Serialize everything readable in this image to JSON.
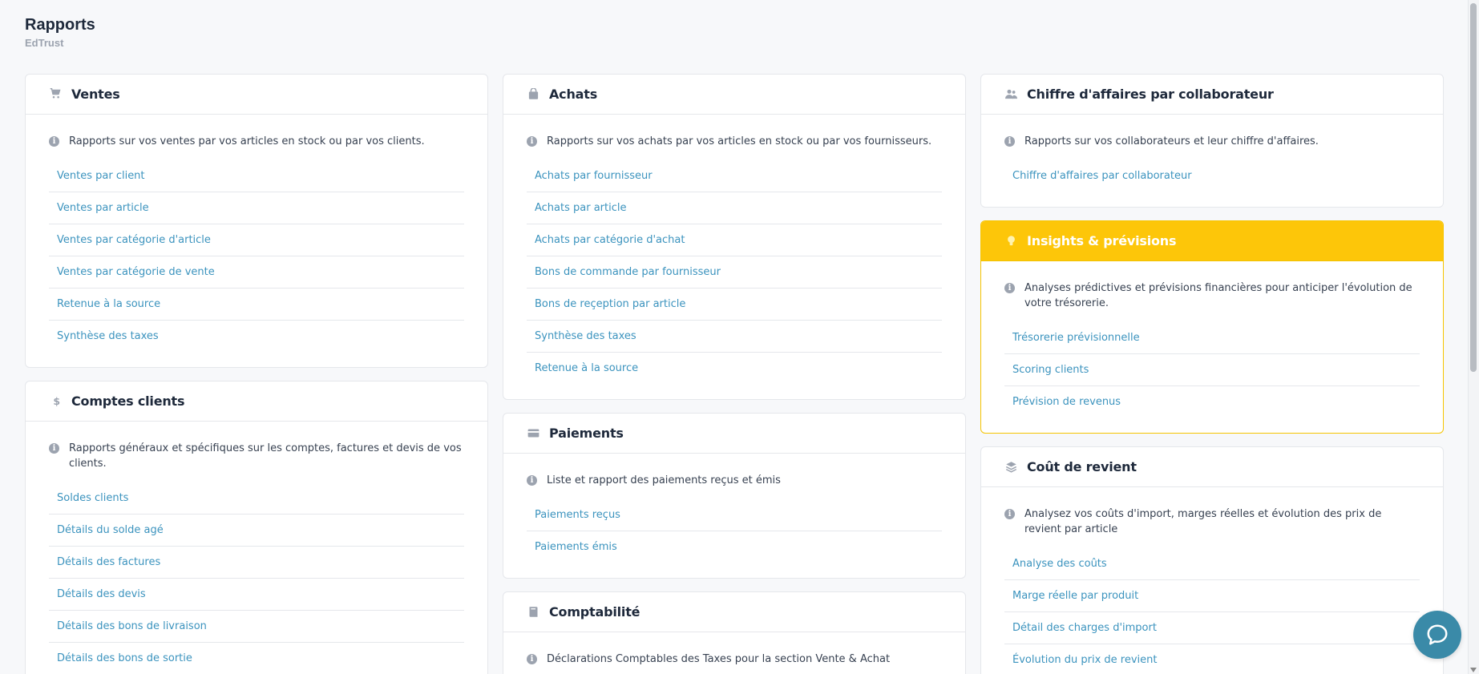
{
  "page": {
    "title": "Rapports",
    "subtitle": "EdTrust"
  },
  "columns": [
    [
      {
        "id": "ventes",
        "title": "Ventes",
        "icon": "cart-icon",
        "description": "Rapports sur vos ventes par vos articles en stock ou par vos clients.",
        "links": [
          "Ventes par client",
          "Ventes par article",
          "Ventes par catégorie d'article",
          "Ventes par catégorie de vente",
          "Retenue à la source",
          "Synthèse des taxes"
        ]
      },
      {
        "id": "comptes-clients",
        "title": "Comptes clients",
        "icon": "dollar-icon",
        "description": "Rapports généraux et spécifiques sur les comptes, factures et devis de vos clients.",
        "links": [
          "Soldes clients",
          "Détails du solde agé",
          "Détails des factures",
          "Détails des devis",
          "Détails des bons de livraison",
          "Détails des bons de sortie"
        ]
      }
    ],
    [
      {
        "id": "achats",
        "title": "Achats",
        "icon": "bag-icon",
        "description": "Rapports sur vos achats par vos articles en stock ou par vos fournisseurs.",
        "links": [
          "Achats par fournisseur",
          "Achats par article",
          "Achats par catégorie d'achat",
          "Bons de commande par fournisseur",
          "Bons de reçeption par article",
          "Synthèse des taxes",
          "Retenue à la source"
        ]
      },
      {
        "id": "paiements",
        "title": "Paiements",
        "icon": "credit-card-icon",
        "description": "Liste et rapport des paiements reçus et émis",
        "links": [
          "Paiements reçus",
          "Paiements émis"
        ]
      },
      {
        "id": "comptabilite",
        "title": "Comptabilité",
        "icon": "book-icon",
        "description": "Déclarations Comptables des Taxes pour la section Vente & Achat",
        "links": []
      }
    ],
    [
      {
        "id": "chiffre-affaires",
        "title": "Chiffre d'affaires par collaborateur",
        "icon": "users-icon",
        "description": "Rapports sur vos collaborateurs et leur chiffre d'affaires.",
        "links": [
          "Chiffre d'affaires par collaborateur"
        ]
      },
      {
        "id": "insights",
        "title": "Insights & prévisions",
        "icon": "lightbulb-icon",
        "highlight": true,
        "description": "Analyses prédictives et prévisions financières pour anticiper l'évolution de votre trésorerie.",
        "links": [
          "Trésorerie prévisionnelle",
          "Scoring clients",
          "Prévision de revenus"
        ]
      },
      {
        "id": "cout-revient",
        "title": "Coût de revient",
        "icon": "layers-icon",
        "description": "Analysez vos coûts d'import, marges réelles et évolution des prix de revient par article",
        "links": [
          "Analyse des coûts",
          "Marge réelle par produit",
          "Détail des charges d'import",
          "Évolution du prix de revient"
        ]
      }
    ]
  ],
  "colors": {
    "link": "#3b93be",
    "highlight": "#fdc609",
    "chat": "#3a8aa8"
  }
}
